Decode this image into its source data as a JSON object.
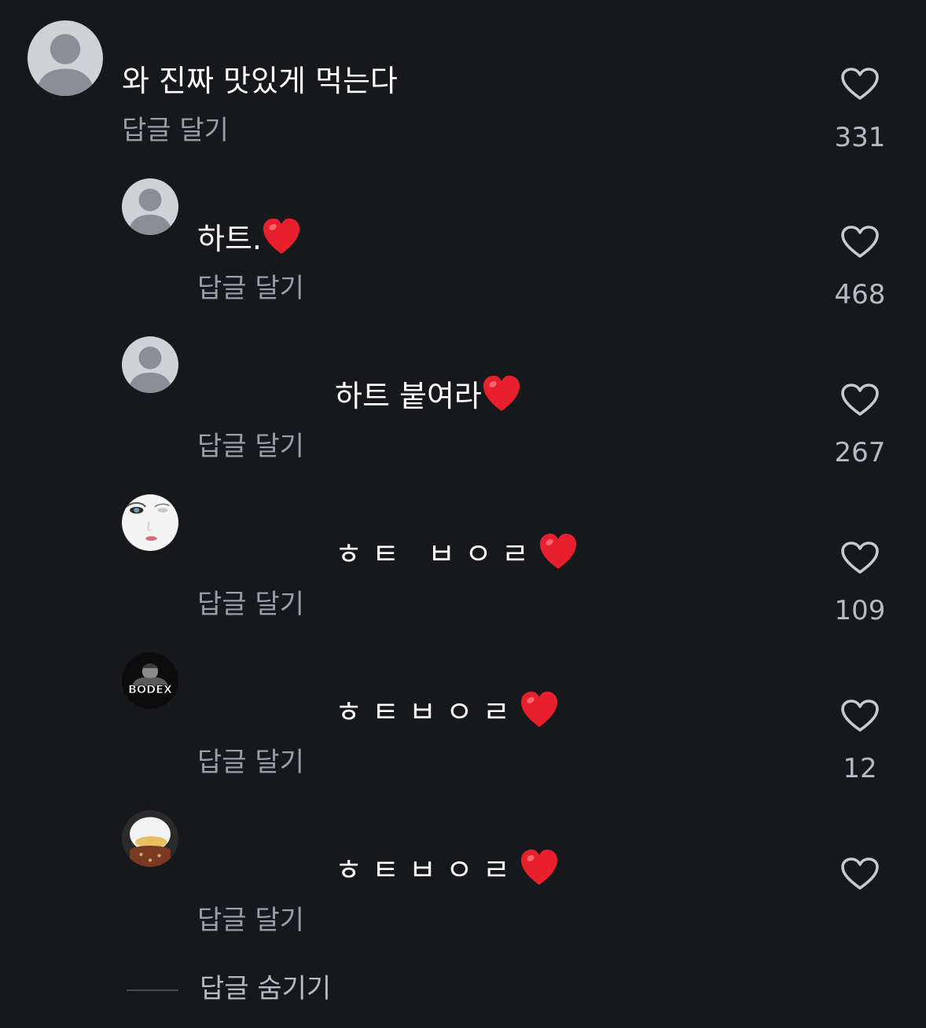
{
  "comments": [
    {
      "text": "와 진짜 맛있게 먹는다",
      "reply_label": "답글 달기",
      "likes": "331",
      "avatar": "default-avatar"
    },
    {
      "text": "하트.",
      "reply_label": "답글 달기",
      "likes": "468",
      "avatar": "default-avatar"
    },
    {
      "text": "하트 붙여라",
      "reply_label": "답글 달기",
      "likes": "267",
      "avatar": "default-avatar"
    },
    {
      "text": "ㅎㅌ ㅂㅇㄹ",
      "reply_label": "답글 달기",
      "likes": "109",
      "avatar": "white-face-avatar"
    },
    {
      "text": "ㅎㅌㅂㅇㄹ",
      "reply_label": "답글 달기",
      "likes": "12",
      "avatar": "bodex-logo-avatar",
      "avatar_text": "BODEX"
    },
    {
      "text": "ㅎㅌㅂㅇㄹ",
      "reply_label": "답글 달기",
      "likes": "",
      "avatar": "duck-character-avatar"
    }
  ],
  "hide_replies_label": "답글 숨기기",
  "colors": {
    "background": "#17181c",
    "text": "#ffffff",
    "secondary_text": "#9a9ea6",
    "count_text": "#b7bac0",
    "icon": "#c8cacf",
    "heart_emoji": "#e8202e"
  },
  "icons": {
    "like": "heart-outline-icon",
    "emoji": "red-heart-emoji"
  }
}
